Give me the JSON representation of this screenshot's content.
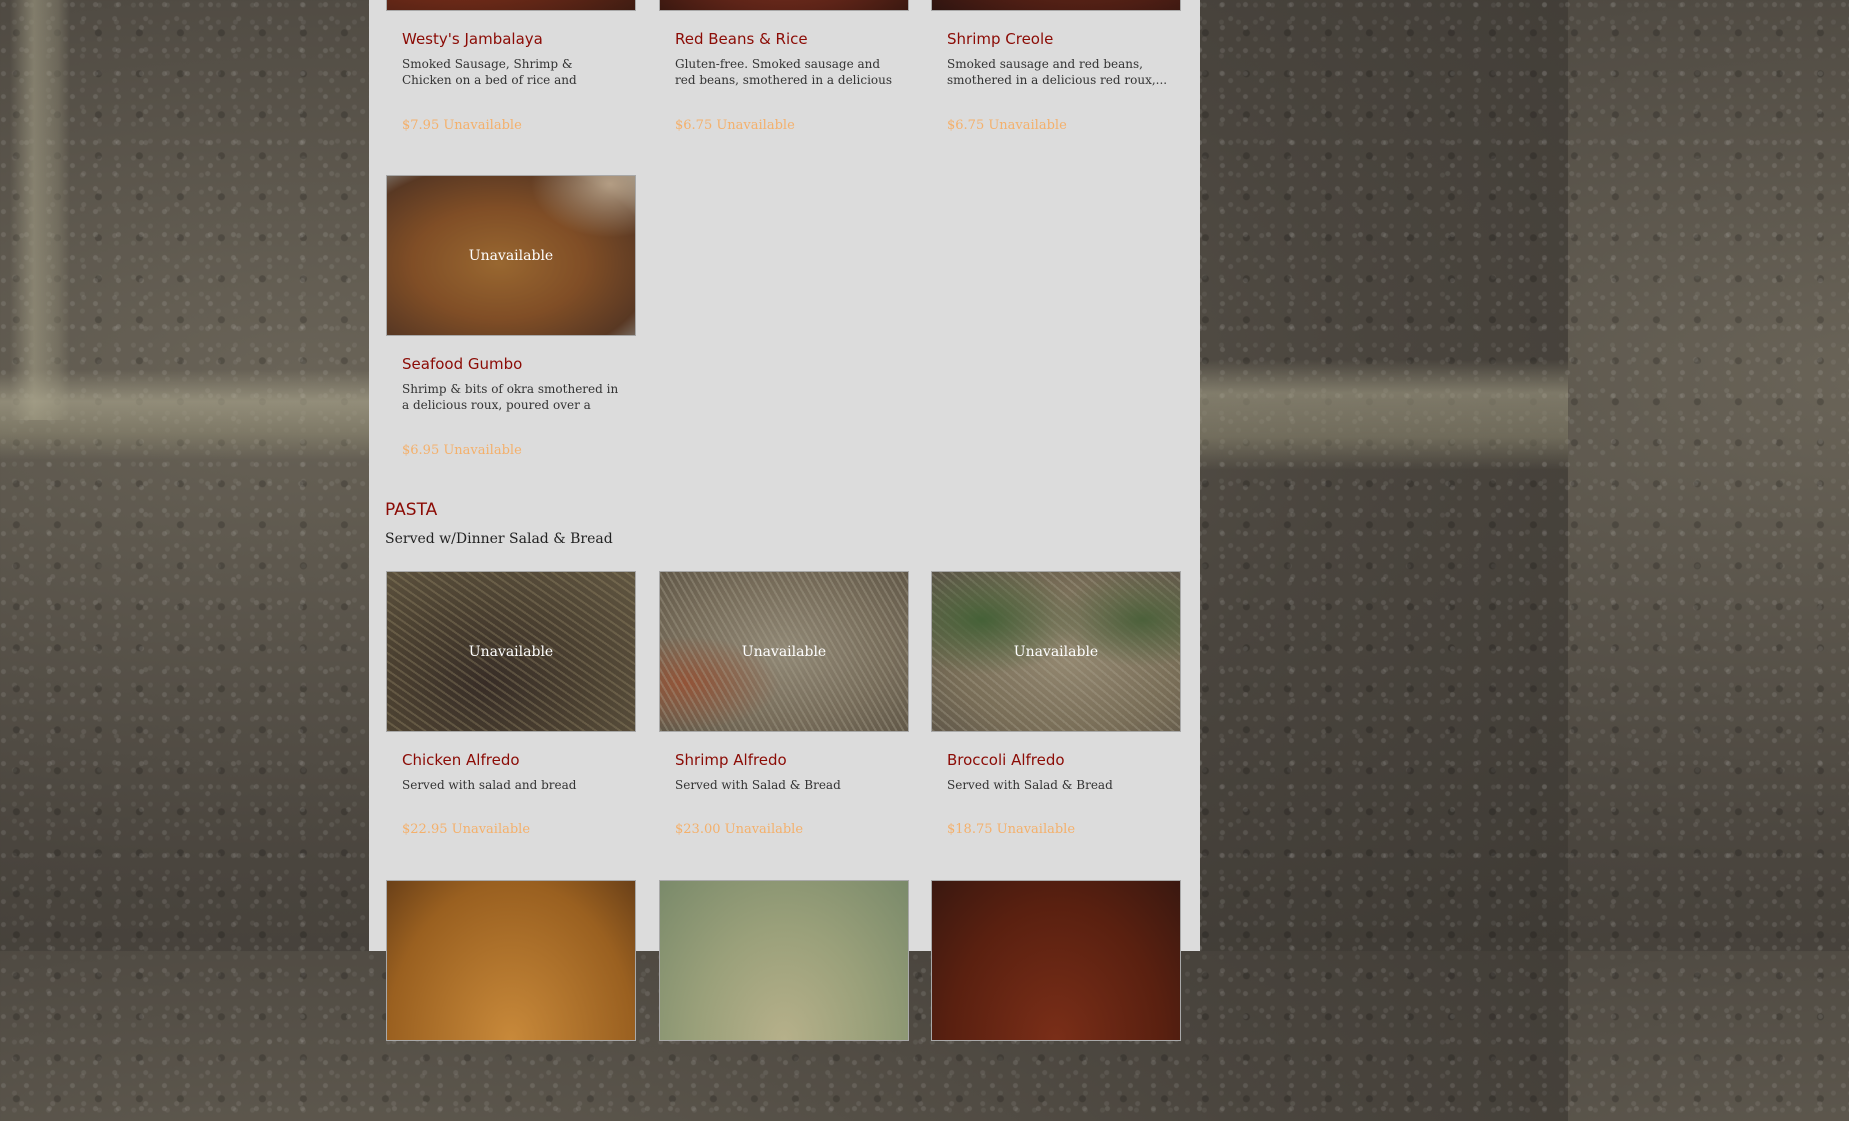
{
  "top_row": [
    {
      "name": "Westy's Jambalaya",
      "description": "Smoked Sausage, Shrimp & Chicken on a bed of rice and smothered with a Creol...",
      "price": "$7.95 Unavailable"
    },
    {
      "name": "Red Beans & Rice",
      "description": "Gluten-free. Smoked sausage and red beans, smothered in a delicious red rou...",
      "price": "$6.75 Unavailable"
    },
    {
      "name": "Shrimp Creole",
      "description": "Smoked sausage and red beans, smothered in a delicious red roux,...",
      "price": "$6.75 Unavailable"
    }
  ],
  "gumbo": {
    "overlay": "Unavailable",
    "name": "Seafood Gumbo",
    "description": "Shrimp & bits of okra smothered in a delicious roux, poured over a mound of...",
    "price": "$6.95 Unavailable"
  },
  "pasta_section": {
    "title": "PASTA",
    "subtitle": "Served w/Dinner Salad & Bread",
    "items": [
      {
        "overlay": "Unavailable",
        "name": "Chicken Alfredo",
        "description": "Served with salad and bread",
        "price": "$22.95 Unavailable"
      },
      {
        "overlay": "Unavailable",
        "name": "Shrimp Alfredo",
        "description": "Served with Salad & Bread",
        "price": "$23.00 Unavailable"
      },
      {
        "overlay": "Unavailable",
        "name": "Broccoli Alfredo",
        "description": "Served with Salad & Bread",
        "price": "$18.75 Unavailable"
      }
    ]
  },
  "colors": {
    "item_title": "#8b0b05",
    "price": "#f4b06b",
    "panel": "#dcdcdc"
  }
}
